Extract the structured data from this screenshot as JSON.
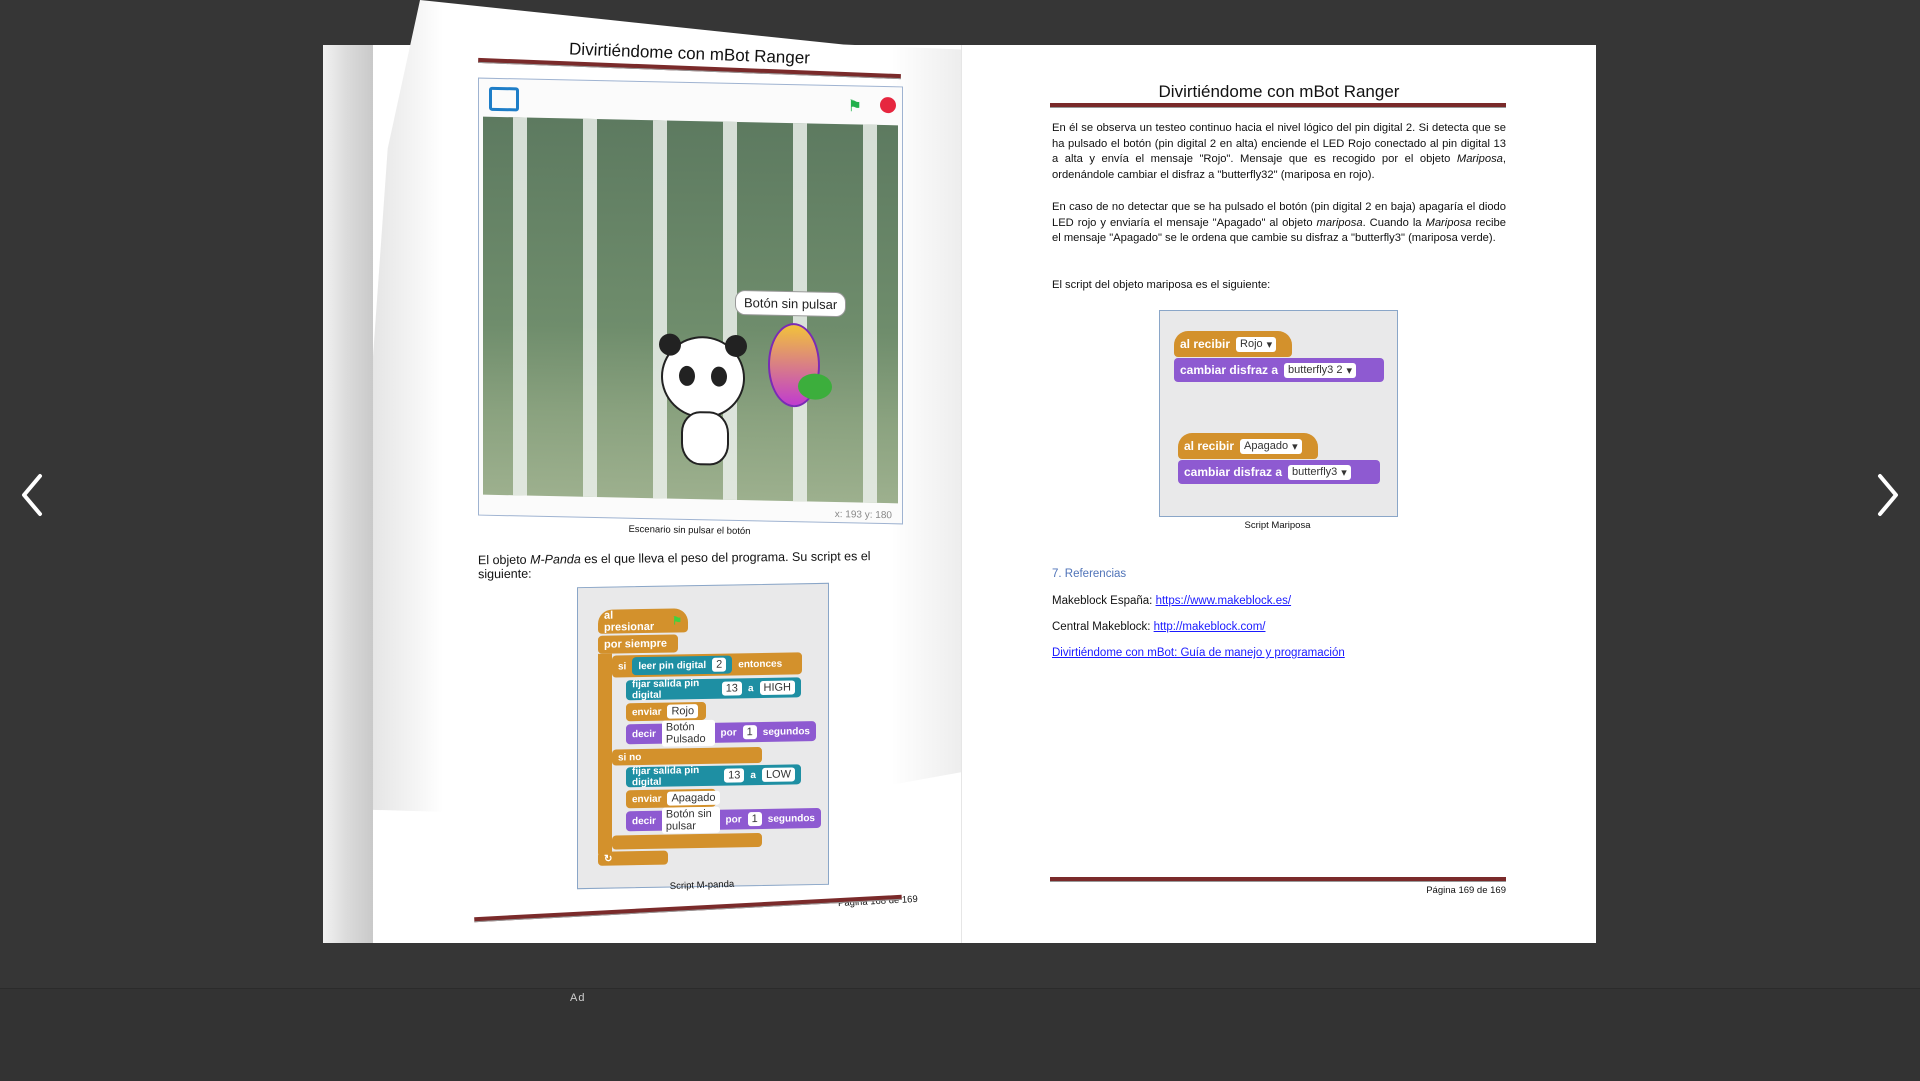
{
  "viewer": {
    "prev_label": "‹",
    "next_label": "›",
    "ad_label": "Ad"
  },
  "left_page": {
    "header": "Divirtiéndome con mBot Ranger",
    "stage": {
      "bubble": "Botón sin pulsar",
      "coords": "x: 193  y: 180",
      "caption": "Escenario sin pulsar el botón"
    },
    "paragraph_pre": "El objeto ",
    "paragraph_obj": "M-Panda",
    "paragraph_post": " es el que lleva el peso del programa. Su script es el siguiente:",
    "script": {
      "hat": "al presionar",
      "forever": "por siempre",
      "if": "si",
      "read": "leer pin digital",
      "read_num": "2",
      "then": "entonces",
      "set1": "fijar salida pin digital",
      "set1_num": "13",
      "set1_a": "a",
      "set1_val": "HIGH",
      "send1": "enviar",
      "send1_val": "Rojo",
      "say1": "decir",
      "say1_val": "Botón Pulsado",
      "say1_por": "por",
      "say1_num": "1",
      "say1_unit": "segundos",
      "else": "si no",
      "set2": "fijar salida pin digital",
      "set2_num": "13",
      "set2_a": "a",
      "set2_val": "LOW",
      "send2": "enviar",
      "send2_val": "Apagado",
      "say2": "decir",
      "say2_val": "Botón sin pulsar",
      "say2_por": "por",
      "say2_num": "1",
      "say2_unit": "segundos"
    },
    "script_caption": "Script M-panda",
    "page_number": "Página 168 de 169"
  },
  "right_page": {
    "header": "Divirtiéndome con mBot Ranger",
    "p1_a": "En él se observa un testeo continuo hacia el nivel lógico del pin digital 2. Si detecta que se ha pulsado el botón (pin digital 2 en alta) enciende el LED Rojo conectado al pin digital 13 a alta y envía el mensaje \"Rojo\". Mensaje que es recogido por el objeto ",
    "p1_obj": "Mariposa",
    "p1_b": ", ordenándole cambiar el disfraz a \"butterfly32\" (mariposa en rojo).",
    "p2_a": "En caso de no detectar que se ha pulsado el botón (pin digital 2 en baja) apagaría el diodo LED rojo y enviaría el mensaje \"Apagado\" al objeto ",
    "p2_obj": "mariposa",
    "p2_b": ". Cuando la ",
    "p2_obj2": "Mariposa",
    "p2_c": " recibe el mensaje \"Apagado\" se le ordena que cambie su disfraz a \"butterfly3\" (mariposa verde).",
    "p3": "El script del objeto mariposa es el siguiente:",
    "script": {
      "recv1": "al recibir",
      "recv1_val": "Rojo",
      "cost1": "cambiar disfraz a",
      "cost1_val": "butterfly3 2",
      "recv2": "al recibir",
      "recv2_val": "Apagado",
      "cost2": "cambiar disfraz a",
      "cost2_val": "butterfly3"
    },
    "script_caption": "Script Mariposa",
    "refs_heading": "7.   Referencias",
    "ref1_label": "Makeblock España: ",
    "ref1_link": "https://www.makeblock.es/",
    "ref2_label": "Central Makeblock: ",
    "ref2_link": "http://makeblock.com/",
    "ref3_link": "Divirtiéndome con mBot: Guía de manejo y programación",
    "page_number": "Página 169 de 169"
  },
  "colors": {
    "background": "#333333",
    "rule": "#7a2a2a",
    "scratch_orange": "#d3912c",
    "scratch_purple": "#8e5ad1",
    "scratch_teal": "#1e8fa3",
    "link": "#1a1aff",
    "heading_blue": "#4f73b8"
  }
}
